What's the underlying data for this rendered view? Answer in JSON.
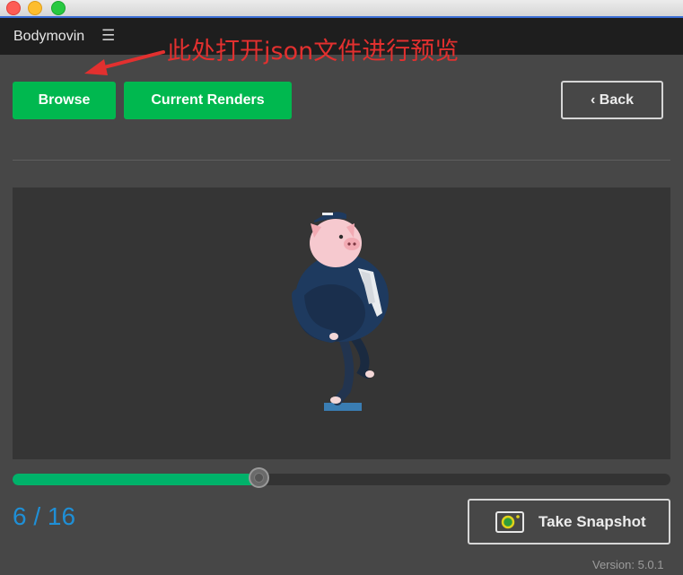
{
  "window": {
    "traffic_lights": [
      "close",
      "minimize",
      "zoom"
    ]
  },
  "app": {
    "title": "Bodymovin",
    "menu_icon": "hamburger-menu-icon"
  },
  "annotation": {
    "text": "此处打开json文件进行预览",
    "color": "#e2302f"
  },
  "toolbar": {
    "browse_label": "Browse",
    "current_renders_label": "Current Renders",
    "back_label": "‹ Back"
  },
  "player": {
    "progress_fraction": 0.375,
    "current_frame": 6,
    "total_frames": 16,
    "frame_text": "6 / 16"
  },
  "snapshot": {
    "label": "Take Snapshot",
    "icon": "camera-icon"
  },
  "footer": {
    "version": "Version: 5.0.1"
  },
  "colors": {
    "accent_green": "#00b84f",
    "frame_blue": "#1f8fd6",
    "background": "#474747",
    "preview_bg": "#353535"
  }
}
